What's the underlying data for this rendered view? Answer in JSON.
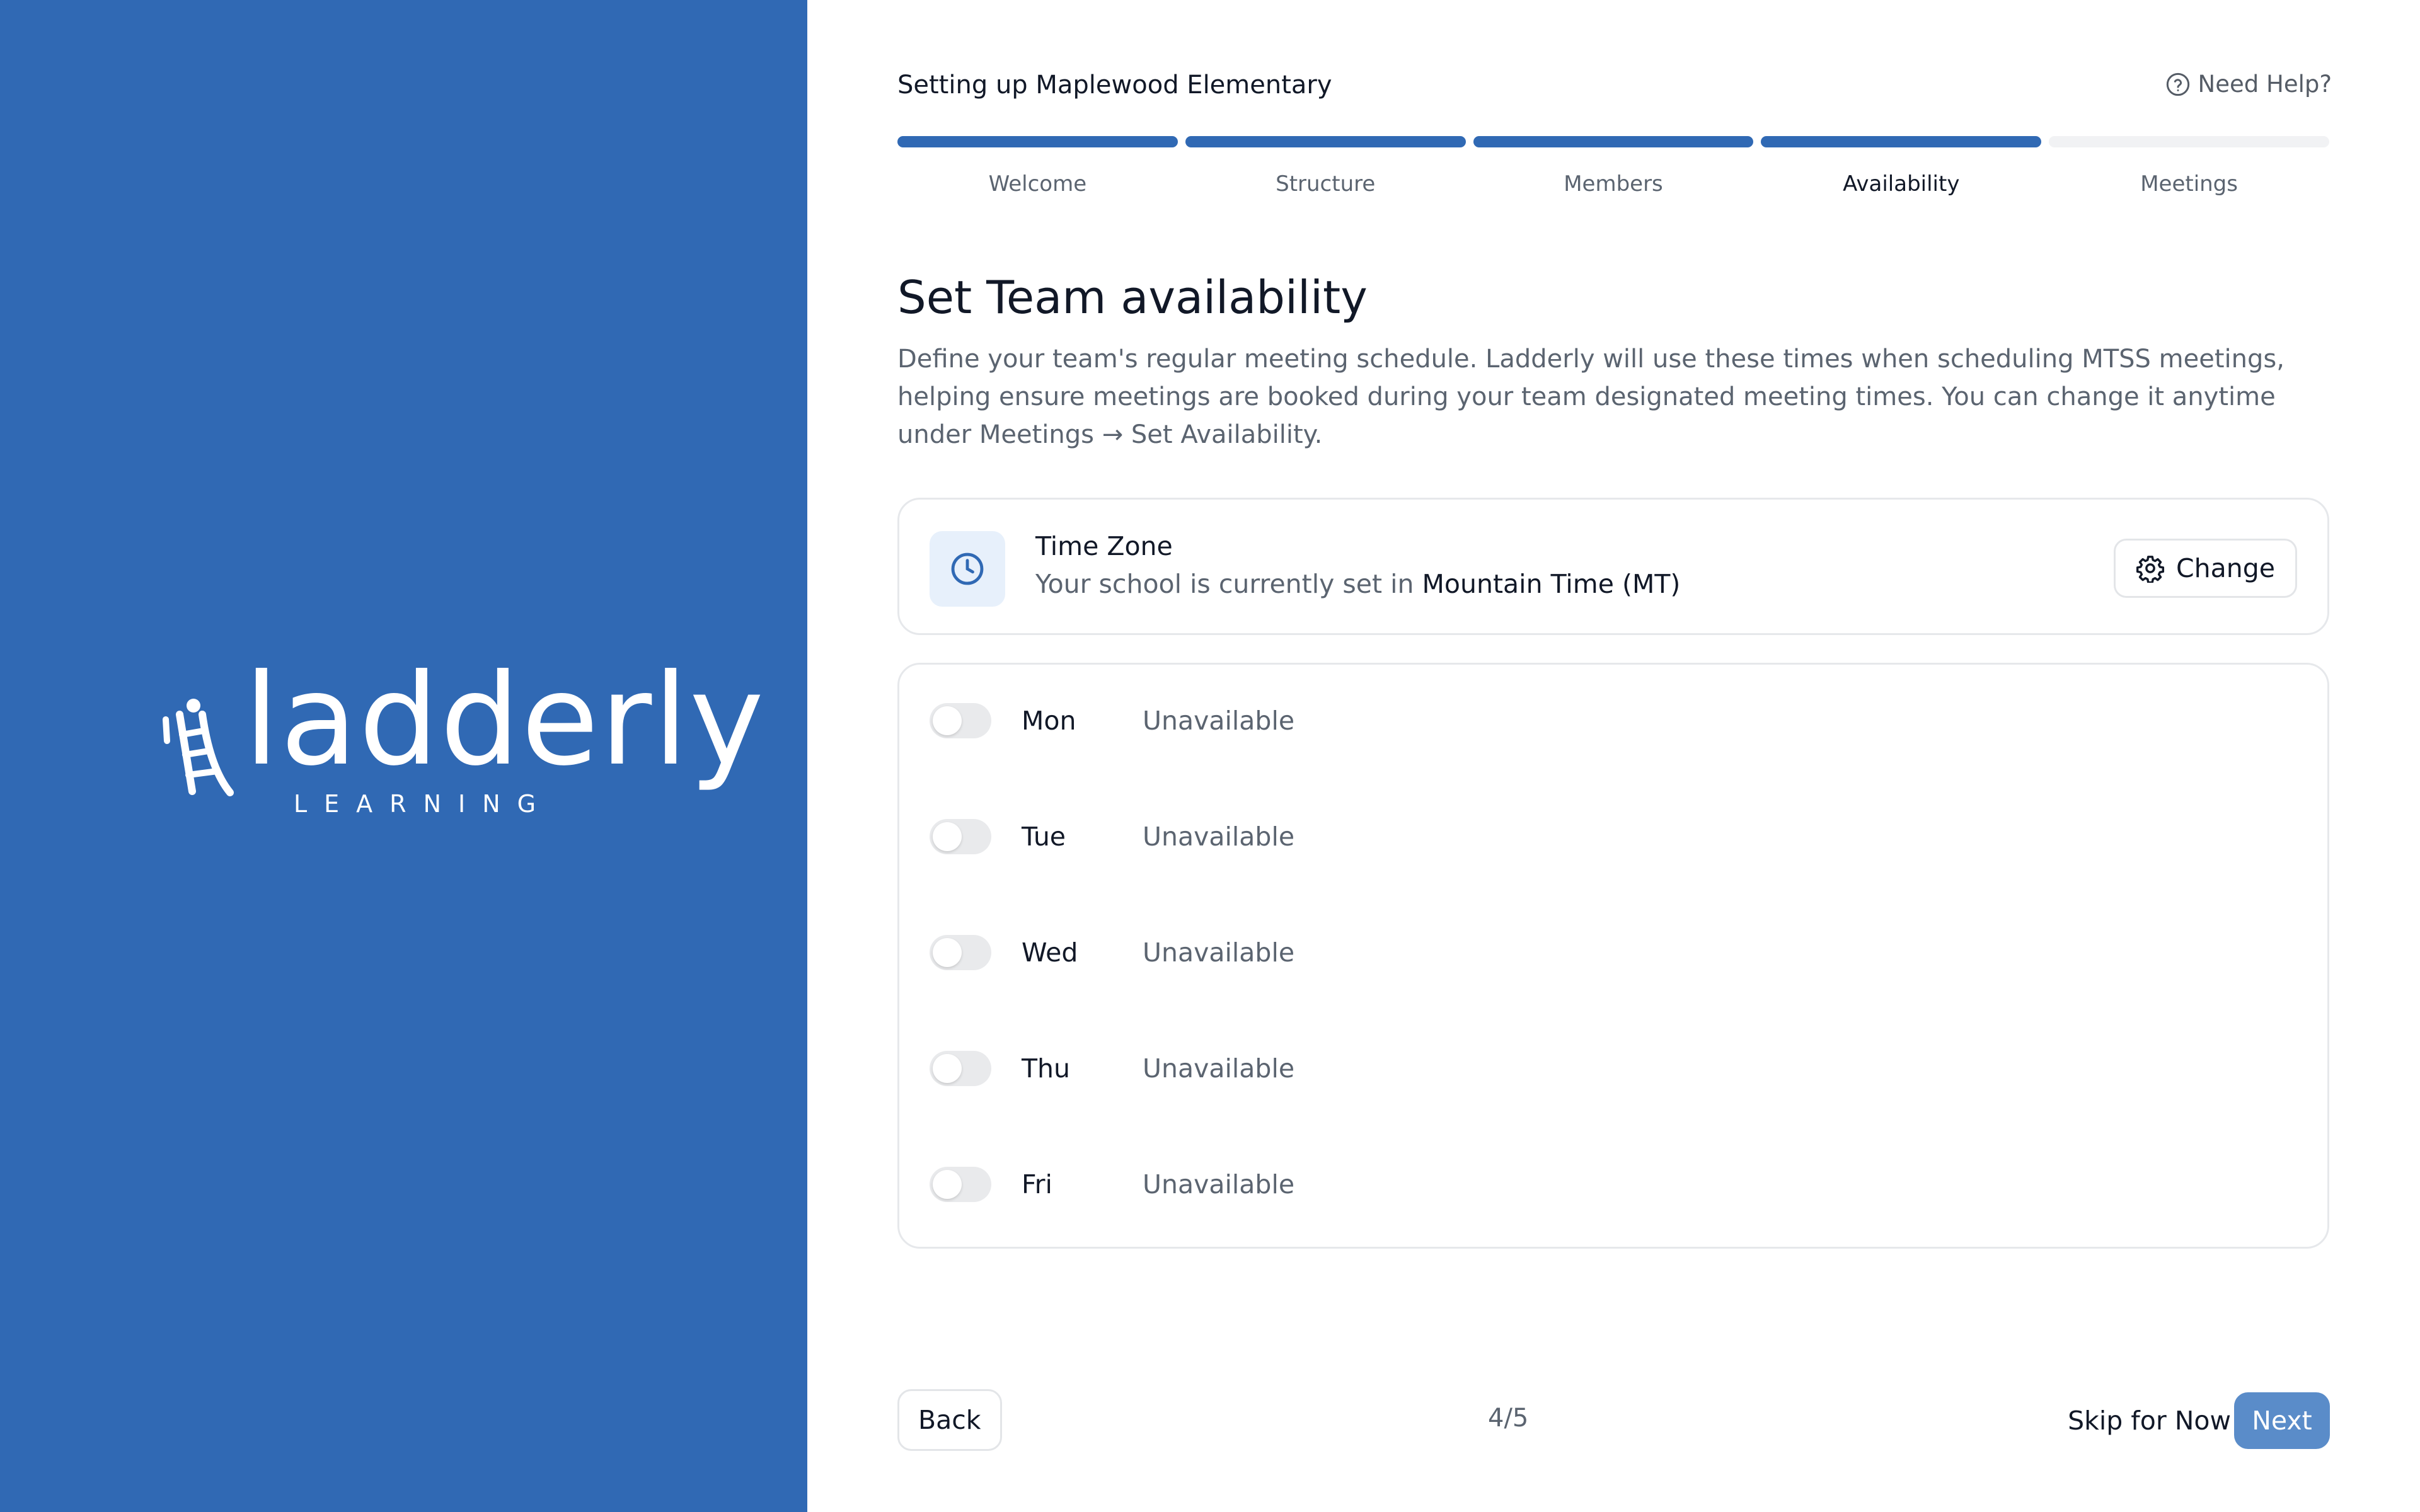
{
  "brand": {
    "name": "ladderly",
    "tagline": "LEARNING",
    "color": "#3069B4"
  },
  "header": {
    "title": "Setting up Maplewood Elementary",
    "help_label": "Need Help?"
  },
  "stepper": {
    "steps": [
      {
        "label": "Welcome",
        "completed": true
      },
      {
        "label": "Structure",
        "completed": true
      },
      {
        "label": "Members",
        "completed": true
      },
      {
        "label": "Availability",
        "completed": true,
        "active": true
      },
      {
        "label": "Meetings",
        "completed": false
      }
    ],
    "accent": "#3069B4"
  },
  "page": {
    "title": "Set Team availability",
    "description": "Define your team's regular meeting schedule. Ladderly will use these times when scheduling MTSS meetings, helping ensure meetings are booked during your team designated meeting times. You can change it anytime under Meetings → Set Availability."
  },
  "timezone": {
    "label": "Time Zone",
    "prefix": "Your school is currently set in",
    "value": "Mountain Time (MT)",
    "change_label": "Change",
    "icon": "clock-icon"
  },
  "days": [
    {
      "name": "Mon",
      "status": "Unavailable",
      "enabled": false
    },
    {
      "name": "Tue",
      "status": "Unavailable",
      "enabled": false
    },
    {
      "name": "Wed",
      "status": "Unavailable",
      "enabled": false
    },
    {
      "name": "Thu",
      "status": "Unavailable",
      "enabled": false
    },
    {
      "name": "Fri",
      "status": "Unavailable",
      "enabled": false
    }
  ],
  "footer": {
    "back_label": "Back",
    "step_count": "4/5",
    "skip_label": "Skip for Now",
    "next_label": "Next"
  }
}
